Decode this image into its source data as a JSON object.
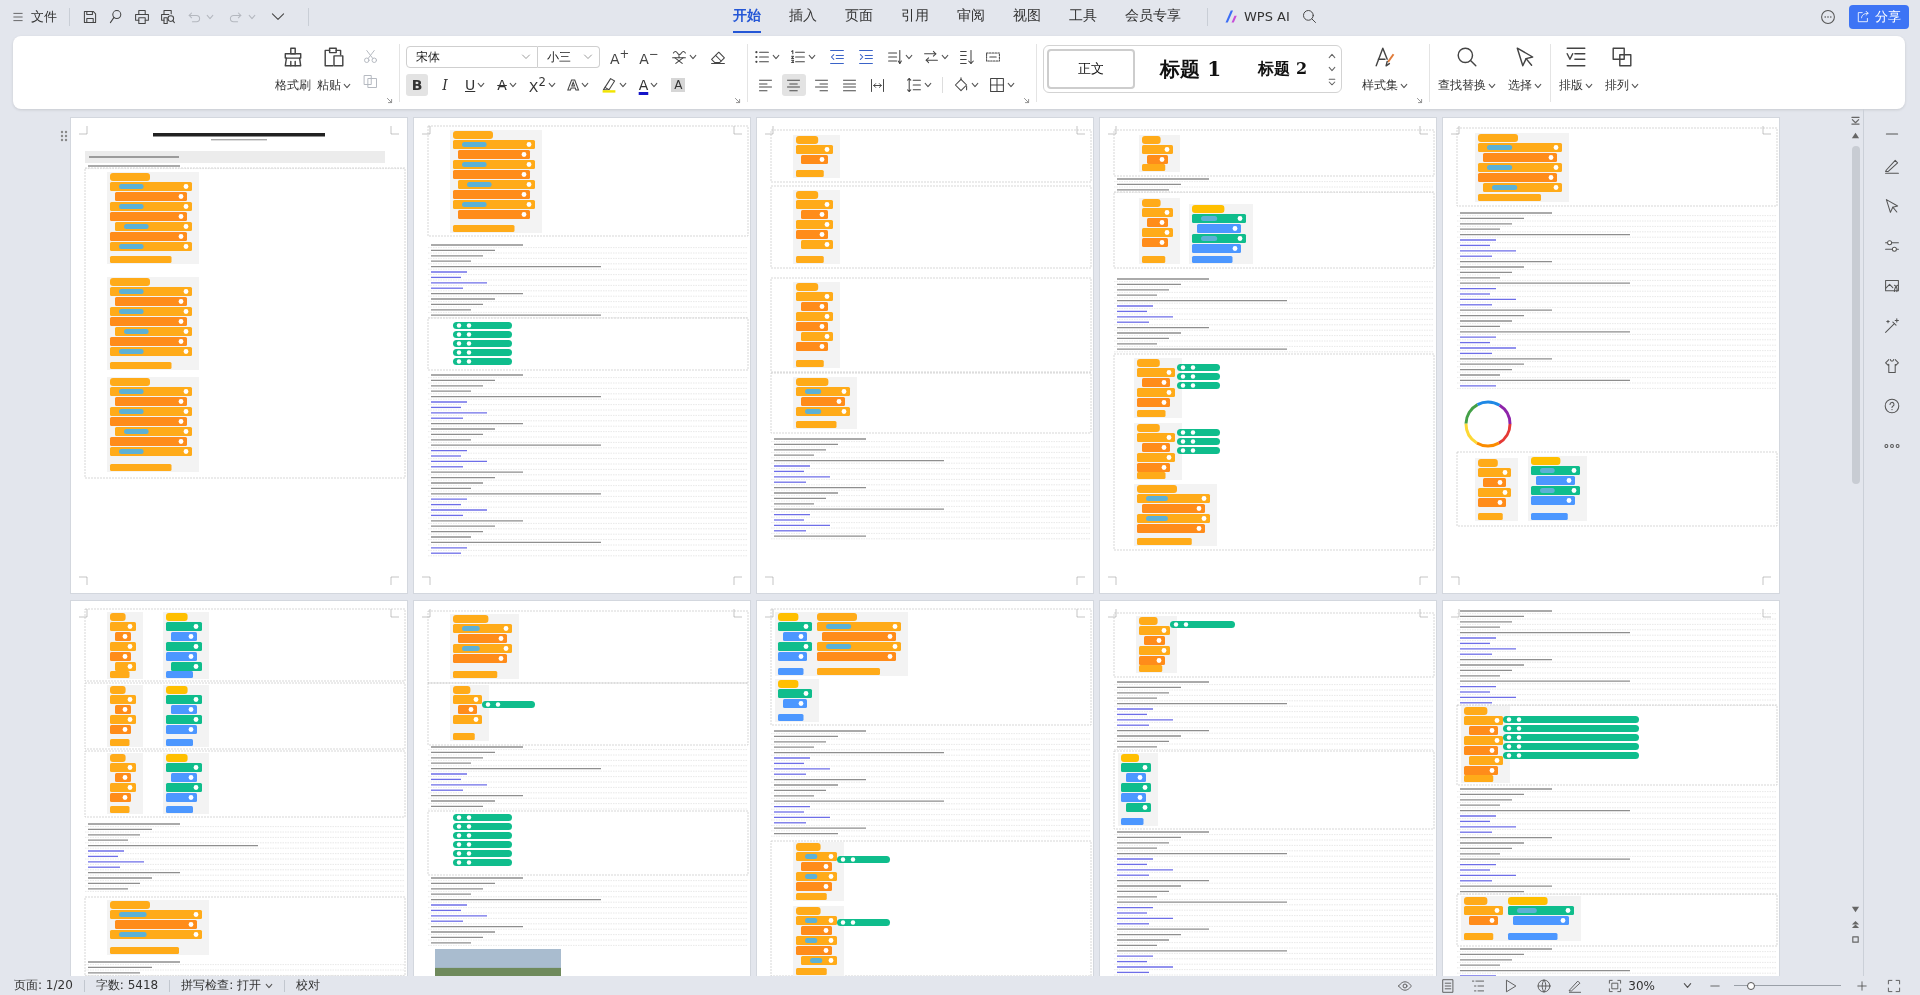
{
  "menu_bar": {
    "file_menu": "文件",
    "quick_access": [
      {
        "kind": "save",
        "disabled": false
      },
      {
        "kind": "loop",
        "disabled": false
      },
      {
        "kind": "print",
        "disabled": false
      },
      {
        "kind": "print_preview",
        "disabled": false
      },
      {
        "kind": "undo",
        "disabled": true
      },
      {
        "kind": "redo",
        "disabled": true
      },
      {
        "kind": "customize",
        "disabled": false
      }
    ],
    "tabs": [
      {
        "label": "开始",
        "selected": true
      },
      {
        "label": "插入",
        "selected": false
      },
      {
        "label": "页面",
        "selected": false
      },
      {
        "label": "引用",
        "selected": false
      },
      {
        "label": "审阅",
        "selected": false
      },
      {
        "label": "视图",
        "selected": false
      },
      {
        "label": "工具",
        "selected": false
      },
      {
        "label": "会员专享",
        "selected": false
      }
    ],
    "ai_button": "WPS AI",
    "share_button": "分享"
  },
  "ribbon": {
    "clipboard": {
      "buttons": [
        {
          "kind": "format_painter",
          "label": "格式刷",
          "has_menu": false
        },
        {
          "kind": "paste",
          "label": "粘贴",
          "has_menu": true
        }
      ],
      "small": [
        {
          "kind": "cut",
          "disabled": true
        },
        {
          "kind": "copy",
          "disabled": true
        }
      ]
    },
    "font": {
      "font_name": "宋体",
      "font_size": "小三",
      "size_buttons": [
        "A$^{+}$",
        "A$^{−}$"
      ],
      "format": [
        {
          "kind": "bold",
          "label": "B",
          "selected": true,
          "has_menu": false
        },
        {
          "kind": "italic",
          "label": "I",
          "selected": false,
          "has_menu": false
        },
        {
          "kind": "underline",
          "label": "U",
          "selected": false,
          "has_menu": true
        },
        {
          "kind": "strikethrough",
          "label": "A",
          "selected": false,
          "has_menu": true
        },
        {
          "kind": "superscript",
          "label": "X$^{2}$",
          "selected": false,
          "has_menu": true
        },
        {
          "kind": "text_effect",
          "label": "A",
          "selected": false,
          "has_menu": true
        },
        {
          "kind": "highlight",
          "selected": false,
          "has_menu": true
        },
        {
          "kind": "font_color",
          "label": "A",
          "selected": false,
          "has_menu": true
        },
        {
          "kind": "shading",
          "label": "A",
          "selected": false,
          "has_menu": false
        }
      ]
    },
    "paragraph": {
      "alignment": [
        {
          "kind": "left",
          "selected": false
        },
        {
          "kind": "center",
          "selected": true
        },
        {
          "kind": "right",
          "selected": false
        },
        {
          "kind": "justify",
          "selected": false
        },
        {
          "kind": "distributed",
          "selected": false
        }
      ]
    },
    "styles": {
      "gallery": [
        {
          "kind": "body",
          "label": "正文",
          "selected": true
        },
        {
          "kind": "heading1",
          "label": "标题 1",
          "selected": false
        },
        {
          "kind": "heading2",
          "label": "标题 2",
          "selected": false
        }
      ],
      "buttons": [
        {
          "kind": "style_set",
          "label": "样式集",
          "has_menu": true
        }
      ]
    },
    "editing": {
      "buttons": [
        {
          "kind": "find_replace",
          "label": "查找替换",
          "has_menu": true
        },
        {
          "kind": "select",
          "label": "选择",
          "has_menu": true
        }
      ]
    },
    "layout": {
      "buttons": [
        {
          "kind": "layout",
          "label": "排版",
          "has_menu": true
        },
        {
          "kind": "arrange",
          "label": "排列",
          "has_menu": true
        }
      ]
    }
  },
  "status_bar": {
    "page": "页面: 1/20",
    "word_count": "字数: 5418",
    "spell_check": "拼写检查: 打开",
    "proofread": "校对",
    "zoom": "30%",
    "zoom_slider": {
      "level": 0.16
    }
  }
}
